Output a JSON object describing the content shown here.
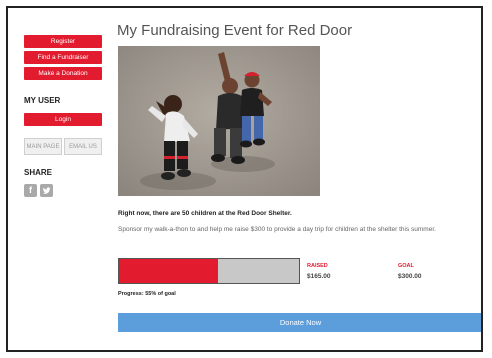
{
  "sidebar": {
    "buttons": [
      "Register",
      "Find a Fundraiser",
      "Make a Donation"
    ],
    "my_user": {
      "title": "MY USER",
      "login": "Login"
    },
    "nav": {
      "main_page": "MAIN PAGE",
      "email_us": "EMAIL US"
    },
    "share": {
      "title": "SHARE",
      "icons": [
        "facebook-icon",
        "twitter-icon"
      ]
    }
  },
  "main": {
    "title": "My Fundraising Event for Red Door",
    "headline": "Right now, there are 50 children at the Red Door Shelter.",
    "description": "Sponsor my walk-a-thon to and help me raise $300 to provide a day trip for children at the shelter this summer.",
    "raised": {
      "label": "RAISED",
      "value": "$165.00"
    },
    "goal": {
      "label": "GOAL",
      "value": "$300.00"
    },
    "progress_fraction": 0.55,
    "progress_text": "Progress: 55% of goal",
    "donate_label": "Donate Now"
  },
  "colors": {
    "accent_red": "#e31b2f",
    "donate_blue": "#5c9ddc"
  }
}
